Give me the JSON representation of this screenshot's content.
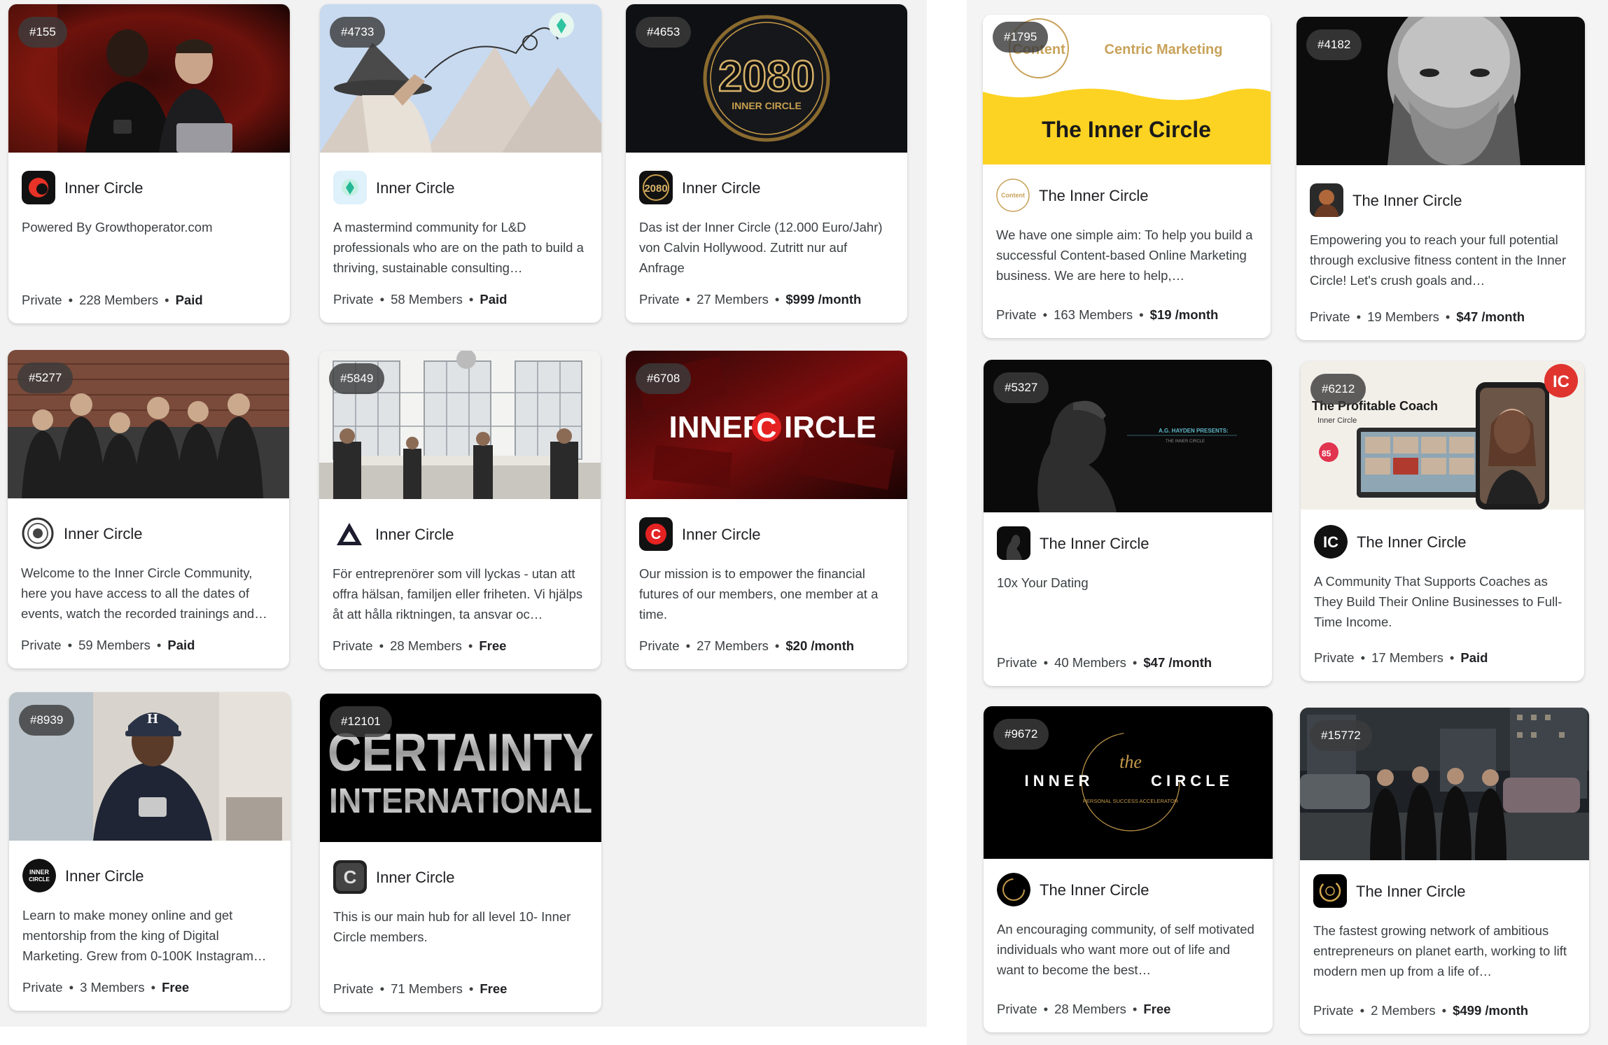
{
  "cards": [
    {
      "rank": "#155",
      "name": "Inner Circle",
      "desc": "Powered By Growthoperator.com",
      "privacy": "Private",
      "members": "228 Members",
      "price": "Paid",
      "avatar_icon": "red-crescent-logo-icon"
    },
    {
      "rank": "#4733",
      "name": "Inner Circle",
      "desc": "A mastermind community for L&D professionals who are on the path to build a thriving, sustainable consulting…",
      "privacy": "Private",
      "members": "58 Members",
      "price": "Paid",
      "avatar_icon": "diamond-logo-icon"
    },
    {
      "rank": "#4653",
      "name": "Inner Circle",
      "desc": "Das ist der Inner Circle (12.000 Euro/Jahr) von Calvin Hollywood. Zutritt nur auf Anfrage",
      "privacy": "Private",
      "members": "27 Members",
      "price": "$999 /month",
      "avatar_icon": "2080-logo-icon",
      "thumb_big": "2080",
      "thumb_small": "INNER CIRCLE"
    },
    {
      "rank": "#5277",
      "name": "Inner Circle",
      "desc": "Welcome to the Inner Circle Community, here you have access to all the dates of events, watch the recorded trainings and…",
      "privacy": "Private",
      "members": "59 Members",
      "price": "Paid",
      "avatar_icon": "circle-emblem-icon"
    },
    {
      "rank": "#5849",
      "name": "Inner Circle",
      "desc": "För entreprenörer som vill lyckas - utan att offra hälsan, familjen eller friheten. Vi hjälps åt att hålla riktningen, ta ansvar oc…",
      "privacy": "Private",
      "members": "28 Members",
      "price": "Free",
      "avatar_icon": "triangle-logo-icon"
    },
    {
      "rank": "#6708",
      "name": "Inner Circle",
      "desc": "Our mission is to empower the financial futures of our members, one member at a time.",
      "privacy": "Private",
      "members": "27 Members",
      "price": "$20 /month",
      "avatar_icon": "red-c-logo-icon",
      "thumb_left": "INNER",
      "thumb_c": "C",
      "thumb_right": "IRCLE"
    },
    {
      "rank": "#8939",
      "name": "Inner Circle",
      "desc": "Learn to make money online and get mentorship from the king of Digital Marketing. Grew from 0-100K Instagram…",
      "privacy": "Private",
      "members": "3 Members",
      "price": "Free",
      "avatar_icon": "inner-circle-badge-icon",
      "avatar_text": "INNER CIRCLE",
      "cap_letter": "H"
    },
    {
      "rank": "#12101",
      "name": "Inner Circle",
      "desc": "This is our main hub for all level 10- Inner Circle members.",
      "privacy": "Private",
      "members": "71 Members",
      "price": "Free",
      "avatar_icon": "certainty-logo-icon",
      "thumb_line1": "CERTAINTY",
      "thumb_line2": "INTERNATIONAL"
    },
    {
      "rank": "#1795",
      "name": "The Inner Circle",
      "desc": "We have one simple aim: To help you build a successful Content-based Online Marketing business. We are here to help,…",
      "privacy": "Private",
      "members": "163 Members",
      "price": "$19 /month",
      "avatar_icon": "content-logo-icon",
      "avatar_text": "Content",
      "thumb_brand1": "Content",
      "thumb_brand2": "Centric Marketing",
      "thumb_title": "The Inner Circle"
    },
    {
      "rank": "#4182",
      "name": "The Inner Circle",
      "desc": "Empowering you to reach your full potential through exclusive fitness content in the Inner Circle! Let's crush goals and…",
      "privacy": "Private",
      "members": "19 Members",
      "price": "$47 /month",
      "avatar_icon": "portrait-avatar-icon"
    },
    {
      "rank": "#5327",
      "name": "The Inner Circle",
      "desc": "10x Your Dating",
      "privacy": "Private",
      "members": "40 Members",
      "price": "$47 /month",
      "avatar_icon": "silhouette-avatar-icon",
      "thumb_line1": "A.G. HAYDEN PRESENTS:",
      "thumb_line2": "THE INNER CIRCLE"
    },
    {
      "rank": "#6212",
      "name": "The Inner Circle",
      "desc": "A Community That Supports Coaches as They Build Their Online Businesses to Full-Time Income.",
      "privacy": "Private",
      "members": "17 Members",
      "price": "Paid",
      "avatar_icon": "ic-logo-icon",
      "avatar_text": "IC",
      "thumb_title": "The Profitable Coach",
      "thumb_sub": "Inner Circle",
      "thumb_badge": "IC"
    },
    {
      "rank": "#9672",
      "name": "The Inner Circle",
      "desc": "An encouraging community, of self motivated individuals who want more out of life and want to become the best…",
      "privacy": "Private",
      "members": "28 Members",
      "price": "Free",
      "avatar_icon": "gold-ring-logo-icon",
      "thumb_left": "I N N E R",
      "thumb_the": "the",
      "thumb_right": "C I R C L E",
      "thumb_sub": "PERSONAL SUCCESS ACCELERATOR"
    },
    {
      "rank": "#15772",
      "name": "The Inner Circle",
      "desc": "The fastest growing network of ambitious entrepreneurs on planet earth, working to lift modern men up from a life of…",
      "privacy": "Private",
      "members": "2 Members",
      "price": "$499 /month",
      "avatar_icon": "gold-swirl-logo-icon"
    }
  ]
}
